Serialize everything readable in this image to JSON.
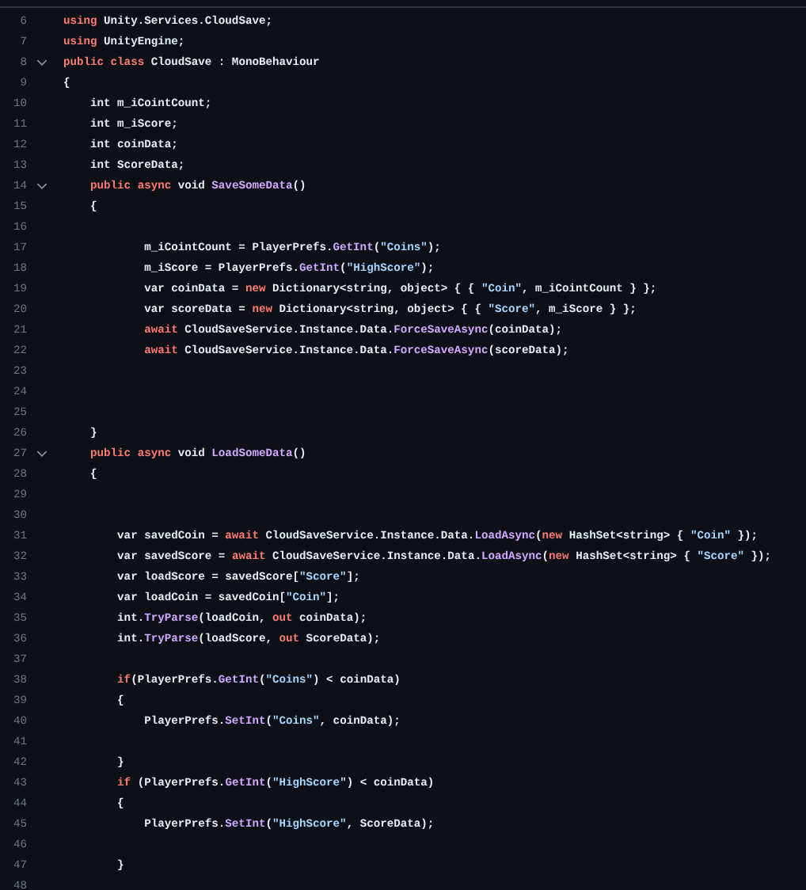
{
  "lines": [
    {
      "n": "6",
      "fold": false,
      "tokens": [
        {
          "kind": "kw",
          "text": "using"
        },
        {
          "kind": "txt",
          "text": " Unity.Services.CloudSave;"
        }
      ]
    },
    {
      "n": "7",
      "fold": false,
      "tokens": [
        {
          "kind": "kw",
          "text": "using"
        },
        {
          "kind": "txt",
          "text": " UnityEngine;"
        }
      ]
    },
    {
      "n": "8",
      "fold": true,
      "tokens": [
        {
          "kind": "kw",
          "text": "public class"
        },
        {
          "kind": "txt",
          "text": " CloudSave : MonoBehaviour"
        }
      ]
    },
    {
      "n": "9",
      "fold": false,
      "tokens": [
        {
          "kind": "txt",
          "text": "{"
        }
      ]
    },
    {
      "n": "10",
      "fold": false,
      "tokens": [
        {
          "kind": "txt",
          "text": "    int m_iCointCount;"
        }
      ]
    },
    {
      "n": "11",
      "fold": false,
      "tokens": [
        {
          "kind": "txt",
          "text": "    int m_iScore;"
        }
      ]
    },
    {
      "n": "12",
      "fold": false,
      "tokens": [
        {
          "kind": "txt",
          "text": "    int coinData;"
        }
      ]
    },
    {
      "n": "13",
      "fold": false,
      "tokens": [
        {
          "kind": "txt",
          "text": "    int ScoreData;"
        }
      ]
    },
    {
      "n": "14",
      "fold": true,
      "tokens": [
        {
          "kind": "kw",
          "text": "    public async"
        },
        {
          "kind": "txt",
          "text": " void "
        },
        {
          "kind": "fn",
          "text": "SaveSomeData"
        },
        {
          "kind": "txt",
          "text": "()"
        }
      ]
    },
    {
      "n": "15",
      "fold": false,
      "tokens": [
        {
          "kind": "txt",
          "text": "    {"
        }
      ]
    },
    {
      "n": "16",
      "fold": false
    },
    {
      "n": "17",
      "fold": false,
      "tokens": [
        {
          "kind": "txt",
          "text": "            m_iCointCount = PlayerPrefs."
        },
        {
          "kind": "fn",
          "text": "GetInt"
        },
        {
          "kind": "txt",
          "text": "("
        },
        {
          "kind": "str",
          "text": "\"Coins\""
        },
        {
          "kind": "txt",
          "text": ");"
        }
      ]
    },
    {
      "n": "18",
      "fold": false,
      "tokens": [
        {
          "kind": "txt",
          "text": "            m_iScore = PlayerPrefs."
        },
        {
          "kind": "fn",
          "text": "GetInt"
        },
        {
          "kind": "txt",
          "text": "("
        },
        {
          "kind": "str",
          "text": "\"HighScore\""
        },
        {
          "kind": "txt",
          "text": ");"
        }
      ]
    },
    {
      "n": "19",
      "fold": false,
      "tokens": [
        {
          "kind": "txt",
          "text": "            var coinData = "
        },
        {
          "kind": "kw",
          "text": "new"
        },
        {
          "kind": "txt",
          "text": " Dictionary<string, object> { { "
        },
        {
          "kind": "str",
          "text": "\"Coin\""
        },
        {
          "kind": "txt",
          "text": ", m_iCointCount } };"
        }
      ]
    },
    {
      "n": "20",
      "fold": false,
      "tokens": [
        {
          "kind": "txt",
          "text": "            var scoreData = "
        },
        {
          "kind": "kw",
          "text": "new"
        },
        {
          "kind": "txt",
          "text": " Dictionary<string, object> { { "
        },
        {
          "kind": "str",
          "text": "\"Score\""
        },
        {
          "kind": "txt",
          "text": ", m_iScore } };"
        }
      ]
    },
    {
      "n": "21",
      "fold": false,
      "tokens": [
        {
          "kind": "kw",
          "text": "            await"
        },
        {
          "kind": "txt",
          "text": " CloudSaveService.Instance.Data."
        },
        {
          "kind": "fn",
          "text": "ForceSaveAsync"
        },
        {
          "kind": "txt",
          "text": "(coinData);"
        }
      ]
    },
    {
      "n": "22",
      "fold": false,
      "tokens": [
        {
          "kind": "kw",
          "text": "            await"
        },
        {
          "kind": "txt",
          "text": " CloudSaveService.Instance.Data."
        },
        {
          "kind": "fn",
          "text": "ForceSaveAsync"
        },
        {
          "kind": "txt",
          "text": "(scoreData);"
        }
      ]
    },
    {
      "n": "23",
      "fold": false
    },
    {
      "n": "24",
      "fold": false
    },
    {
      "n": "25",
      "fold": false
    },
    {
      "n": "26",
      "fold": false,
      "tokens": [
        {
          "kind": "txt",
          "text": "    }"
        }
      ]
    },
    {
      "n": "27",
      "fold": true,
      "tokens": [
        {
          "kind": "kw",
          "text": "    public async"
        },
        {
          "kind": "txt",
          "text": " void "
        },
        {
          "kind": "fn",
          "text": "LoadSomeData"
        },
        {
          "kind": "txt",
          "text": "()"
        }
      ]
    },
    {
      "n": "28",
      "fold": false,
      "tokens": [
        {
          "kind": "txt",
          "text": "    {"
        }
      ]
    },
    {
      "n": "29",
      "fold": false
    },
    {
      "n": "30",
      "fold": false
    },
    {
      "n": "31",
      "fold": false,
      "tokens": [
        {
          "kind": "txt",
          "text": "        var savedCoin = "
        },
        {
          "kind": "kw",
          "text": "await"
        },
        {
          "kind": "txt",
          "text": " CloudSaveService.Instance.Data."
        },
        {
          "kind": "fn",
          "text": "LoadAsync"
        },
        {
          "kind": "txt",
          "text": "("
        },
        {
          "kind": "kw",
          "text": "new"
        },
        {
          "kind": "txt",
          "text": " HashSet<string> { "
        },
        {
          "kind": "str",
          "text": "\"Coin\""
        },
        {
          "kind": "txt",
          "text": " });"
        }
      ]
    },
    {
      "n": "32",
      "fold": false,
      "tokens": [
        {
          "kind": "txt",
          "text": "        var savedScore = "
        },
        {
          "kind": "kw",
          "text": "await"
        },
        {
          "kind": "txt",
          "text": " CloudSaveService.Instance.Data."
        },
        {
          "kind": "fn",
          "text": "LoadAsync"
        },
        {
          "kind": "txt",
          "text": "("
        },
        {
          "kind": "kw",
          "text": "new"
        },
        {
          "kind": "txt",
          "text": " HashSet<string> { "
        },
        {
          "kind": "str",
          "text": "\"Score\""
        },
        {
          "kind": "txt",
          "text": " });"
        }
      ]
    },
    {
      "n": "33",
      "fold": false,
      "tokens": [
        {
          "kind": "txt",
          "text": "        var loadScore = savedScore["
        },
        {
          "kind": "str",
          "text": "\"Score\""
        },
        {
          "kind": "txt",
          "text": "];"
        }
      ]
    },
    {
      "n": "34",
      "fold": false,
      "tokens": [
        {
          "kind": "txt",
          "text": "        var loadCoin = savedCoin["
        },
        {
          "kind": "str",
          "text": "\"Coin\""
        },
        {
          "kind": "txt",
          "text": "];"
        }
      ]
    },
    {
      "n": "35",
      "fold": false,
      "tokens": [
        {
          "kind": "txt",
          "text": "        int."
        },
        {
          "kind": "fn",
          "text": "TryParse"
        },
        {
          "kind": "txt",
          "text": "(loadCoin, "
        },
        {
          "kind": "kw",
          "text": "out"
        },
        {
          "kind": "txt",
          "text": " coinData);"
        }
      ]
    },
    {
      "n": "36",
      "fold": false,
      "tokens": [
        {
          "kind": "txt",
          "text": "        int."
        },
        {
          "kind": "fn",
          "text": "TryParse"
        },
        {
          "kind": "txt",
          "text": "(loadScore, "
        },
        {
          "kind": "kw",
          "text": "out"
        },
        {
          "kind": "txt",
          "text": " ScoreData);"
        }
      ]
    },
    {
      "n": "37",
      "fold": false
    },
    {
      "n": "38",
      "fold": false,
      "tokens": [
        {
          "kind": "kw",
          "text": "        if"
        },
        {
          "kind": "txt",
          "text": "(PlayerPrefs."
        },
        {
          "kind": "fn",
          "text": "GetInt"
        },
        {
          "kind": "txt",
          "text": "("
        },
        {
          "kind": "str",
          "text": "\"Coins\""
        },
        {
          "kind": "txt",
          "text": ") < coinData)"
        }
      ]
    },
    {
      "n": "39",
      "fold": false,
      "tokens": [
        {
          "kind": "txt",
          "text": "        {"
        }
      ]
    },
    {
      "n": "40",
      "fold": false,
      "tokens": [
        {
          "kind": "txt",
          "text": "            PlayerPrefs."
        },
        {
          "kind": "fn",
          "text": "SetInt"
        },
        {
          "kind": "txt",
          "text": "("
        },
        {
          "kind": "str",
          "text": "\"Coins\""
        },
        {
          "kind": "txt",
          "text": ", coinData);"
        }
      ]
    },
    {
      "n": "41",
      "fold": false
    },
    {
      "n": "42",
      "fold": false,
      "tokens": [
        {
          "kind": "txt",
          "text": "        }"
        }
      ]
    },
    {
      "n": "43",
      "fold": false,
      "tokens": [
        {
          "kind": "kw",
          "text": "        if"
        },
        {
          "kind": "txt",
          "text": " (PlayerPrefs."
        },
        {
          "kind": "fn",
          "text": "GetInt"
        },
        {
          "kind": "txt",
          "text": "("
        },
        {
          "kind": "str",
          "text": "\"HighScore\""
        },
        {
          "kind": "txt",
          "text": ") < coinData)"
        }
      ]
    },
    {
      "n": "44",
      "fold": false,
      "tokens": [
        {
          "kind": "txt",
          "text": "        {"
        }
      ]
    },
    {
      "n": "45",
      "fold": false,
      "tokens": [
        {
          "kind": "txt",
          "text": "            PlayerPrefs."
        },
        {
          "kind": "fn",
          "text": "SetInt"
        },
        {
          "kind": "txt",
          "text": "("
        },
        {
          "kind": "str",
          "text": "\"HighScore\""
        },
        {
          "kind": "txt",
          "text": ", ScoreData);"
        }
      ]
    },
    {
      "n": "46",
      "fold": false
    },
    {
      "n": "47",
      "fold": false,
      "tokens": [
        {
          "kind": "txt",
          "text": "        }"
        }
      ]
    },
    {
      "n": "48",
      "fold": false
    }
  ]
}
